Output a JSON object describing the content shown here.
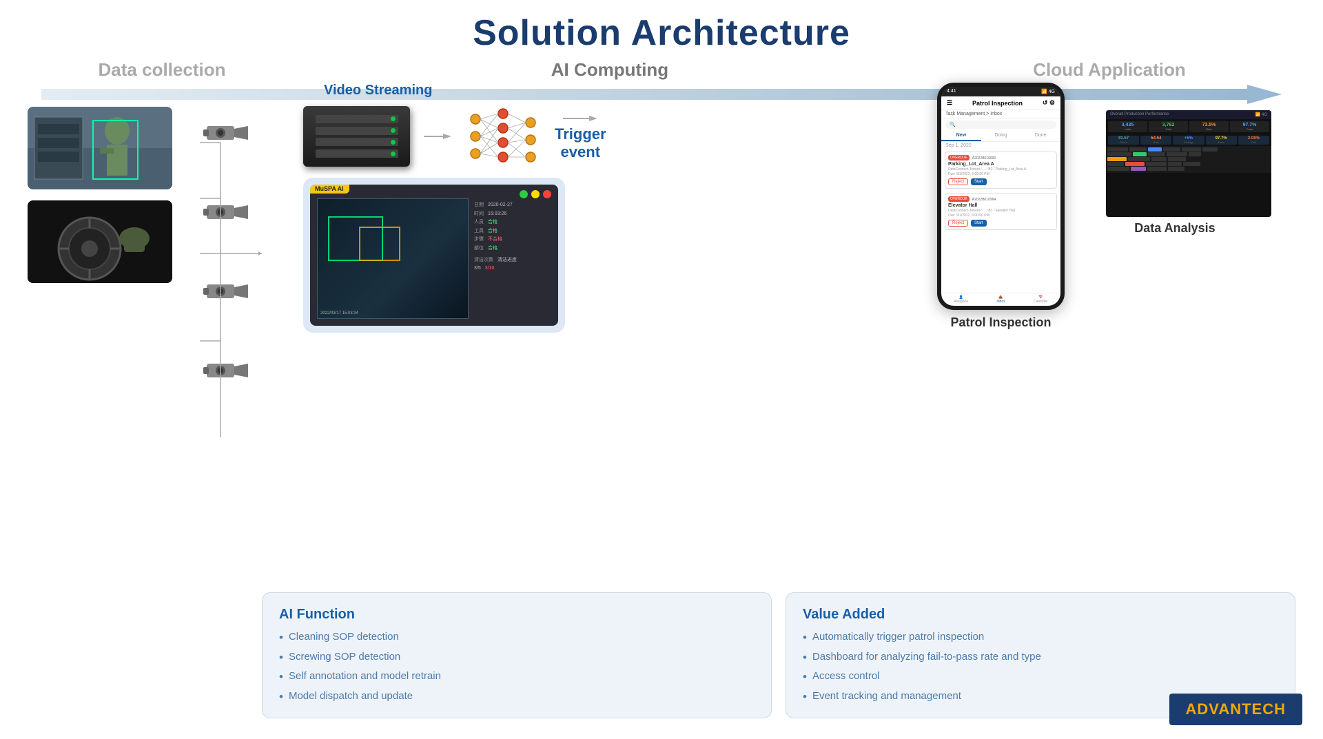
{
  "title": "Solution Architecture",
  "phases": {
    "data_collection": "Data collection",
    "ai_computing": "AI Computing",
    "cloud_application": "Cloud Application"
  },
  "labels": {
    "video_streaming": "Video Streaming",
    "trigger_event_line1": "Trigger",
    "trigger_event_line2": "event",
    "ai_function_title": "AI Function",
    "value_added_title": "Value Added",
    "patrol_inspection": "Patrol Inspection",
    "data_analysis": "Data Analysis"
  },
  "ai_functions": [
    "Cleaning SOP detection",
    "Screwing SOP detection",
    "Self annotation and  model retrain",
    "Model dispatch and update"
  ],
  "value_added": [
    "Automatically trigger patrol inspection",
    "Dashboard for analyzing fail-to-pass rate and type",
    "Access control",
    "Event tracking and management"
  ],
  "phone": {
    "time": "4:41",
    "title": "Patrol Inspection",
    "tabs": [
      "New",
      "Doing",
      "Done"
    ],
    "date": "Sep 1, 2022",
    "inbox_label": "Inbox",
    "card1": {
      "badge": "OVERDUE",
      "id": "A2022B010992",
      "location": "Parking_Lot_Area A",
      "subloc": "DataConnect-Tenant / ... / B1 / Parking_Lot_Area A",
      "due": "Due: 9/1/2022, 6:00:00 PM"
    },
    "card2": {
      "badge": "OVERDUE",
      "id": "A2022B010964",
      "location": "Elevator Hall",
      "subloc": "DataConnect-Tenant / ... / B1 / Elevator Hall",
      "due": "Due: 9/1/2022, 6:00:00 PM"
    },
    "btn_reject": "Reject",
    "btn_start": "Start",
    "nav": [
      "Assignee",
      "Inbox",
      "Calendar"
    ]
  },
  "advantech": {
    "text_ad": "AD",
    "text_vantech": "VANTECH"
  },
  "muspa_label": "MuSPA AI",
  "dots": {
    "green": "#2ecc40",
    "yellow": "#ffdc00",
    "red": "#ff4136"
  },
  "colors": {
    "title_blue": "#1a3c6e",
    "accent_blue": "#1a5fa8",
    "bullet_blue": "#4a7aaa",
    "box_bg": "#eef3f9",
    "box_border": "#ccd8e8",
    "arrow_blue": "#a8c4e0"
  }
}
